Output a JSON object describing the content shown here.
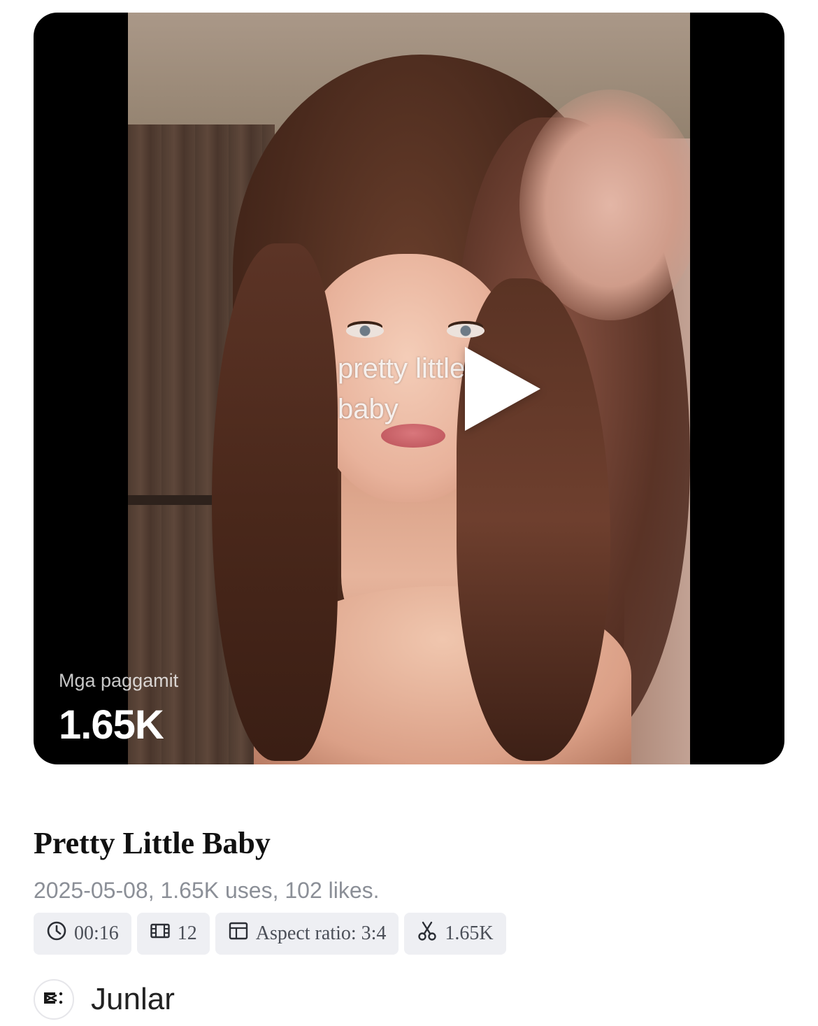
{
  "video": {
    "overlay_text_line1": "pretty little",
    "overlay_text_line2": "baby",
    "uses_label": "Mga paggamit",
    "uses_value": "1.65K"
  },
  "template": {
    "title": "Pretty Little Baby",
    "meta": "2025-05-08, 1.65K uses, 102 likes.",
    "tags": {
      "duration": "00:16",
      "clips": "12",
      "aspect_ratio": "Aspect ratio: 3:4",
      "uses": "1.65K"
    }
  },
  "author": {
    "name": "Junlar",
    "avatar_icon": "capcut-logo-icon"
  },
  "icons": {
    "duration": "clock-icon",
    "clips": "film-icon",
    "aspect_ratio": "layout-icon",
    "uses": "scissors-icon",
    "play": "play-icon"
  }
}
